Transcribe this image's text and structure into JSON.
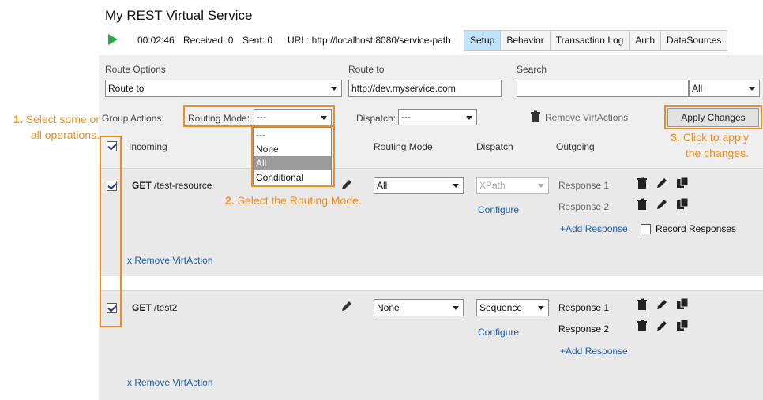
{
  "window": {
    "title": "My REST Virtual Service"
  },
  "status": {
    "time": "00:02:46",
    "received": "Received: 0",
    "sent": "Sent: 0",
    "url": "URL: http://localhost:8080/service-path"
  },
  "tabs": [
    "Setup",
    "Behavior",
    "Transaction Log",
    "Auth",
    "DataSources"
  ],
  "route": {
    "options_label": "Route Options",
    "options_value": "Route to",
    "to_label": "Route to",
    "to_value": "http://dev.myservice.com",
    "search_label": "Search",
    "search_value": "",
    "search_scope": "All"
  },
  "group_actions": {
    "label": "Group Actions:",
    "routing_mode_label": "Routing Mode:",
    "routing_mode_value": "---",
    "routing_mode_options": [
      "---",
      "None",
      "All",
      "Conditional"
    ],
    "routing_mode_selected": "All",
    "dispatch_label": "Dispatch:",
    "dispatch_value": "---",
    "remove_label": "Remove VirtActions",
    "apply_label": "Apply Changes"
  },
  "columns": {
    "incoming": "Incoming",
    "routing_mode": "Routing Mode",
    "dispatch": "Dispatch",
    "outgoing": "Outgoing"
  },
  "operations": [
    {
      "method": "GET",
      "path": "/test-resource",
      "routing_mode": "All",
      "dispatch": "XPath",
      "configure": "Configure",
      "responses": [
        "Response 1",
        "Response 2"
      ],
      "add_response": "+Add Response",
      "record_label": "Record Responses",
      "remove": "x Remove VirtAction"
    },
    {
      "method": "GET",
      "path": "/test2",
      "routing_mode": "None",
      "dispatch": "Sequence",
      "configure": "Configure",
      "responses": [
        "Response 1",
        "Response 2"
      ],
      "add_response": "+Add Response",
      "remove": "x Remove VirtAction"
    }
  ],
  "annotations": {
    "a1_num": "1.",
    "a1_text": "Select some or",
    "a1_text2": "all operations.",
    "a2_num": "2.",
    "a2_text": "Select the Routing Mode.",
    "a3_num": "3.",
    "a3_text": "Click to apply",
    "a3_text2": "the changes."
  },
  "colors": {
    "accent": "#f28c1e",
    "tab_active": "#bfe3fb",
    "link": "#1a5eb0",
    "play": "#28a745"
  }
}
